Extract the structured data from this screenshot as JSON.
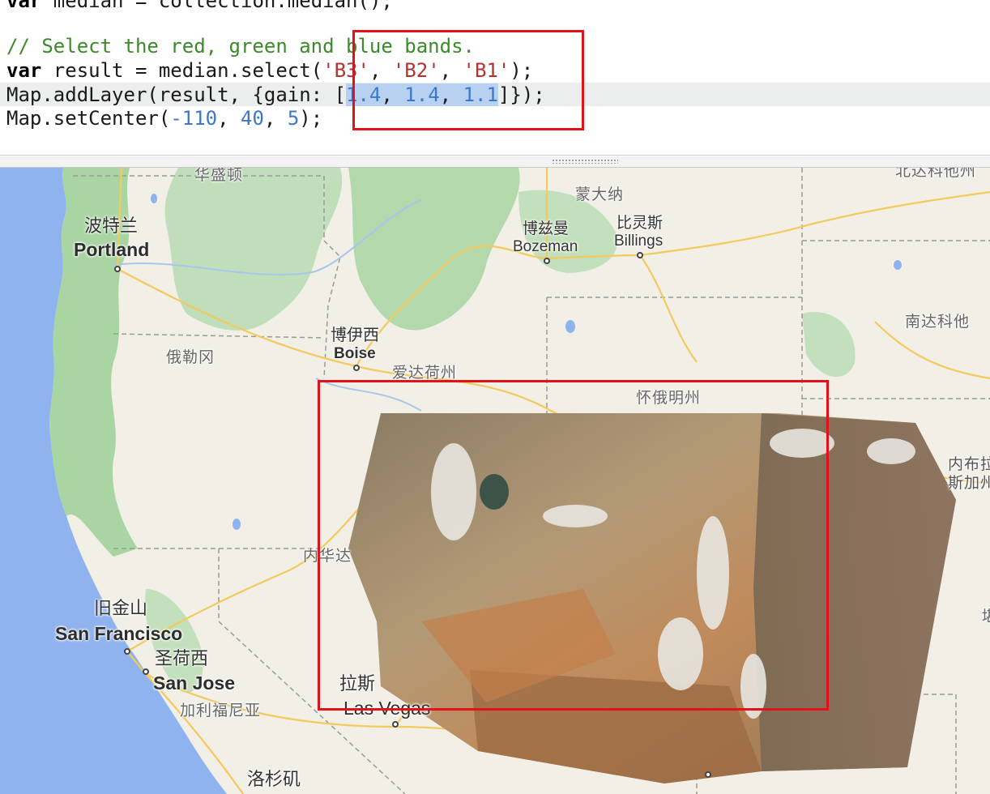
{
  "editor": {
    "lines": [
      {
        "segments": [
          {
            "t": "var",
            "c": "kw"
          },
          {
            "t": " median = collection.median();",
            "c": ""
          }
        ]
      },
      {
        "segments": []
      },
      {
        "segments": [
          {
            "t": "// Select the red, green and blue bands.",
            "c": "cmt"
          }
        ]
      },
      {
        "segments": [
          {
            "t": "var",
            "c": "kw"
          },
          {
            "t": " result = median.select(",
            "c": ""
          },
          {
            "t": "'B3'",
            "c": "str"
          },
          {
            "t": ", ",
            "c": ""
          },
          {
            "t": "'B2'",
            "c": "str"
          },
          {
            "t": ", ",
            "c": ""
          },
          {
            "t": "'B1'",
            "c": "str"
          },
          {
            "t": ");",
            "c": ""
          }
        ]
      },
      {
        "segments": [
          {
            "t": "Map.addLayer(result, {gain: [",
            "c": ""
          },
          {
            "t": "1.4",
            "c": "num sel"
          },
          {
            "t": ", ",
            "c": "sel"
          },
          {
            "t": "1.4",
            "c": "num sel"
          },
          {
            "t": ", ",
            "c": "sel"
          },
          {
            "t": "1.1",
            "c": "num sel"
          },
          {
            "t": "]});",
            "c": ""
          }
        ]
      },
      {
        "segments": [
          {
            "t": "Map.setCenter(",
            "c": ""
          },
          {
            "t": "-110",
            "c": "num"
          },
          {
            "t": ", ",
            "c": ""
          },
          {
            "t": "40",
            "c": "num"
          },
          {
            "t": ", ",
            "c": ""
          },
          {
            "t": "5",
            "c": "num"
          },
          {
            "t": ");",
            "c": ""
          }
        ]
      }
    ]
  },
  "map": {
    "labels": {
      "washington": "华盛顿",
      "montana": "蒙大纳",
      "north_dakota": "北达科他州",
      "portland_zh": "波特兰",
      "portland_en": "Portland",
      "bozeman_zh": "博兹曼",
      "bozeman_en": "Bozeman",
      "billings_zh": "比灵斯",
      "billings_en": "Billings",
      "south_dakota": "南达科他",
      "boise_zh": "博伊西",
      "boise_en": "Boise",
      "oregon": "俄勒冈",
      "idaho": "爱达荷州",
      "wyoming": "怀俄明州",
      "nebraska_1": "内布拉",
      "nebraska_2": "斯加州",
      "nevada": "内华达",
      "sf_zh": "旧金山",
      "sf_en": "San Francisco",
      "sj_zh": "圣荷西",
      "sj_en": "San Jose",
      "california": "加利福尼亚",
      "lv_zh": "拉斯",
      "lv_en": "Las Vegas",
      "la_zh": "洛杉矶",
      "edge_char": "堪"
    },
    "colors": {
      "water": "#8fb3ee",
      "land": "#f1efe6",
      "forest": "#a7d3a0",
      "roads": "#f6cf6a",
      "annotation": "#e3121a"
    }
  }
}
